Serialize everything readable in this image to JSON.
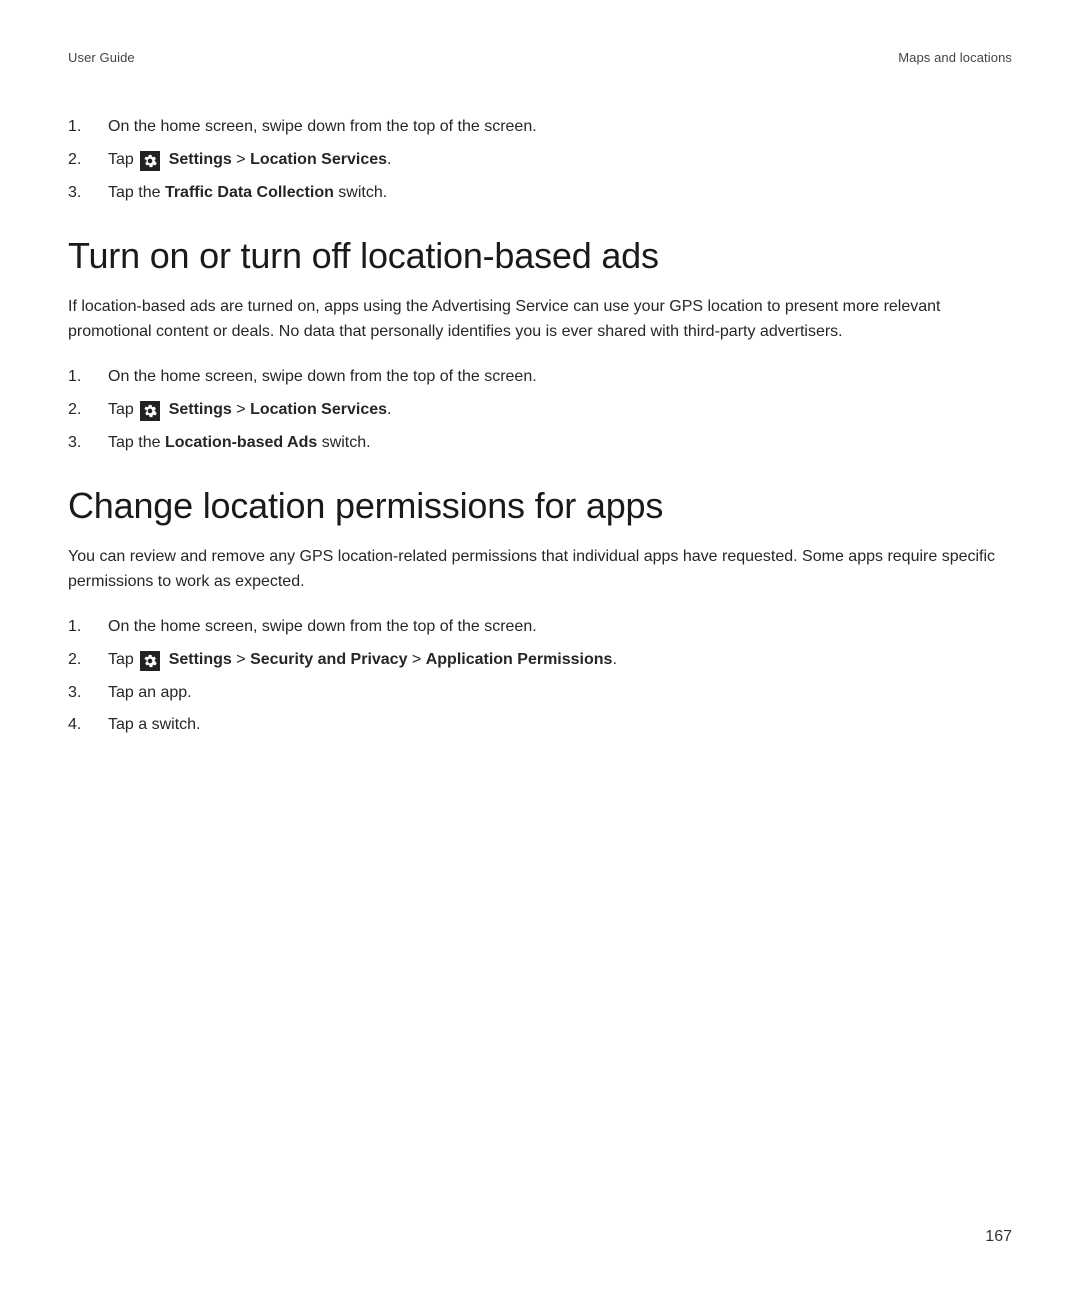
{
  "header": {
    "left": "User Guide",
    "right": "Maps and locations"
  },
  "section0": {
    "items": [
      {
        "num": "1.",
        "pre": "On the home screen, swipe down from the top of the screen."
      },
      {
        "num": "2.",
        "pre": "Tap ",
        "hasIcon": true,
        "post1": "Settings",
        "sep1": " > ",
        "post2": "Location Services",
        "tail": "."
      },
      {
        "num": "3.",
        "pre": "Tap the ",
        "post1": "Traffic Data Collection",
        "tail": " switch."
      }
    ]
  },
  "section1": {
    "heading": "Turn on or turn off location-based ads",
    "para": "If location-based ads are turned on, apps using the Advertising Service can use your GPS location to present more relevant promotional content or deals. No data that personally identifies you is ever shared with third-party advertisers.",
    "items": [
      {
        "num": "1.",
        "pre": "On the home screen, swipe down from the top of the screen."
      },
      {
        "num": "2.",
        "pre": "Tap ",
        "hasIcon": true,
        "post1": "Settings",
        "sep1": " > ",
        "post2": "Location Services",
        "tail": "."
      },
      {
        "num": "3.",
        "pre": "Tap the ",
        "post1": "Location-based Ads",
        "tail": " switch."
      }
    ]
  },
  "section2": {
    "heading": "Change location permissions for apps",
    "para": "You can review and remove any GPS location-related permissions that individual apps have requested. Some apps require specific permissions to work as expected.",
    "items": [
      {
        "num": "1.",
        "pre": "On the home screen, swipe down from the top of the screen."
      },
      {
        "num": "2.",
        "pre": "Tap ",
        "hasIcon": true,
        "post1": "Settings",
        "sep1": " > ",
        "post2": "Security and Privacy",
        "sep2": " > ",
        "post3": "Application Permissions",
        "tail": "."
      },
      {
        "num": "3.",
        "pre": "Tap an app."
      },
      {
        "num": "4.",
        "pre": "Tap a switch."
      }
    ]
  },
  "footer": {
    "pageNumber": "167"
  },
  "iconSvg": "gear-icon"
}
